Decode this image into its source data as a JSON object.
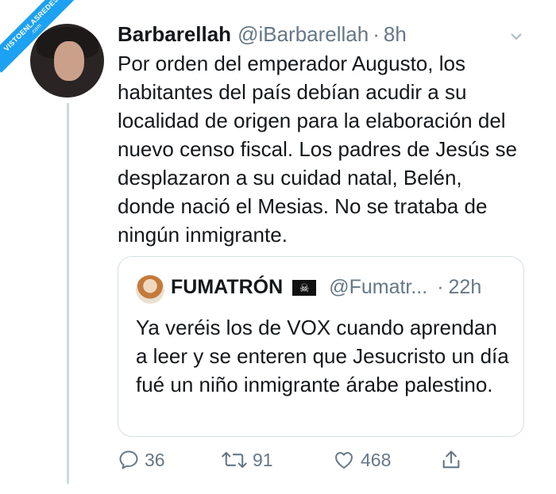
{
  "watermark": {
    "line1": "VISTOENLASREDES",
    "line2": ".com"
  },
  "tweet": {
    "name": "Barbarellah",
    "handle": "@iBarbarellah",
    "separator": "·",
    "time": "8h",
    "text": "Por orden del emperador Augusto, los habitantes del país debían acudir a su localidad de origen para la elaboración del nuevo censo fiscal. Los padres de Jesús se desplazaron a su cuidad natal, Belén, donde nació el Mesias. No se trataba de ningún inmigrante."
  },
  "quoted": {
    "name": "FUMATRÓN",
    "flag": "☠",
    "handle": "@Fumatr...",
    "separator": "·",
    "time": "22h",
    "text": "Ya veréis los de VOX cuando aprendan a leer y se enteren que Jesucristo un día fué un niño inmigrante árabe palestino."
  },
  "actions": {
    "reply_count": "36",
    "retweet_count": "91",
    "like_count": "468"
  },
  "icons": [
    "chevron-down-icon",
    "reply-icon",
    "retweet-icon",
    "heart-icon",
    "share-icon"
  ]
}
